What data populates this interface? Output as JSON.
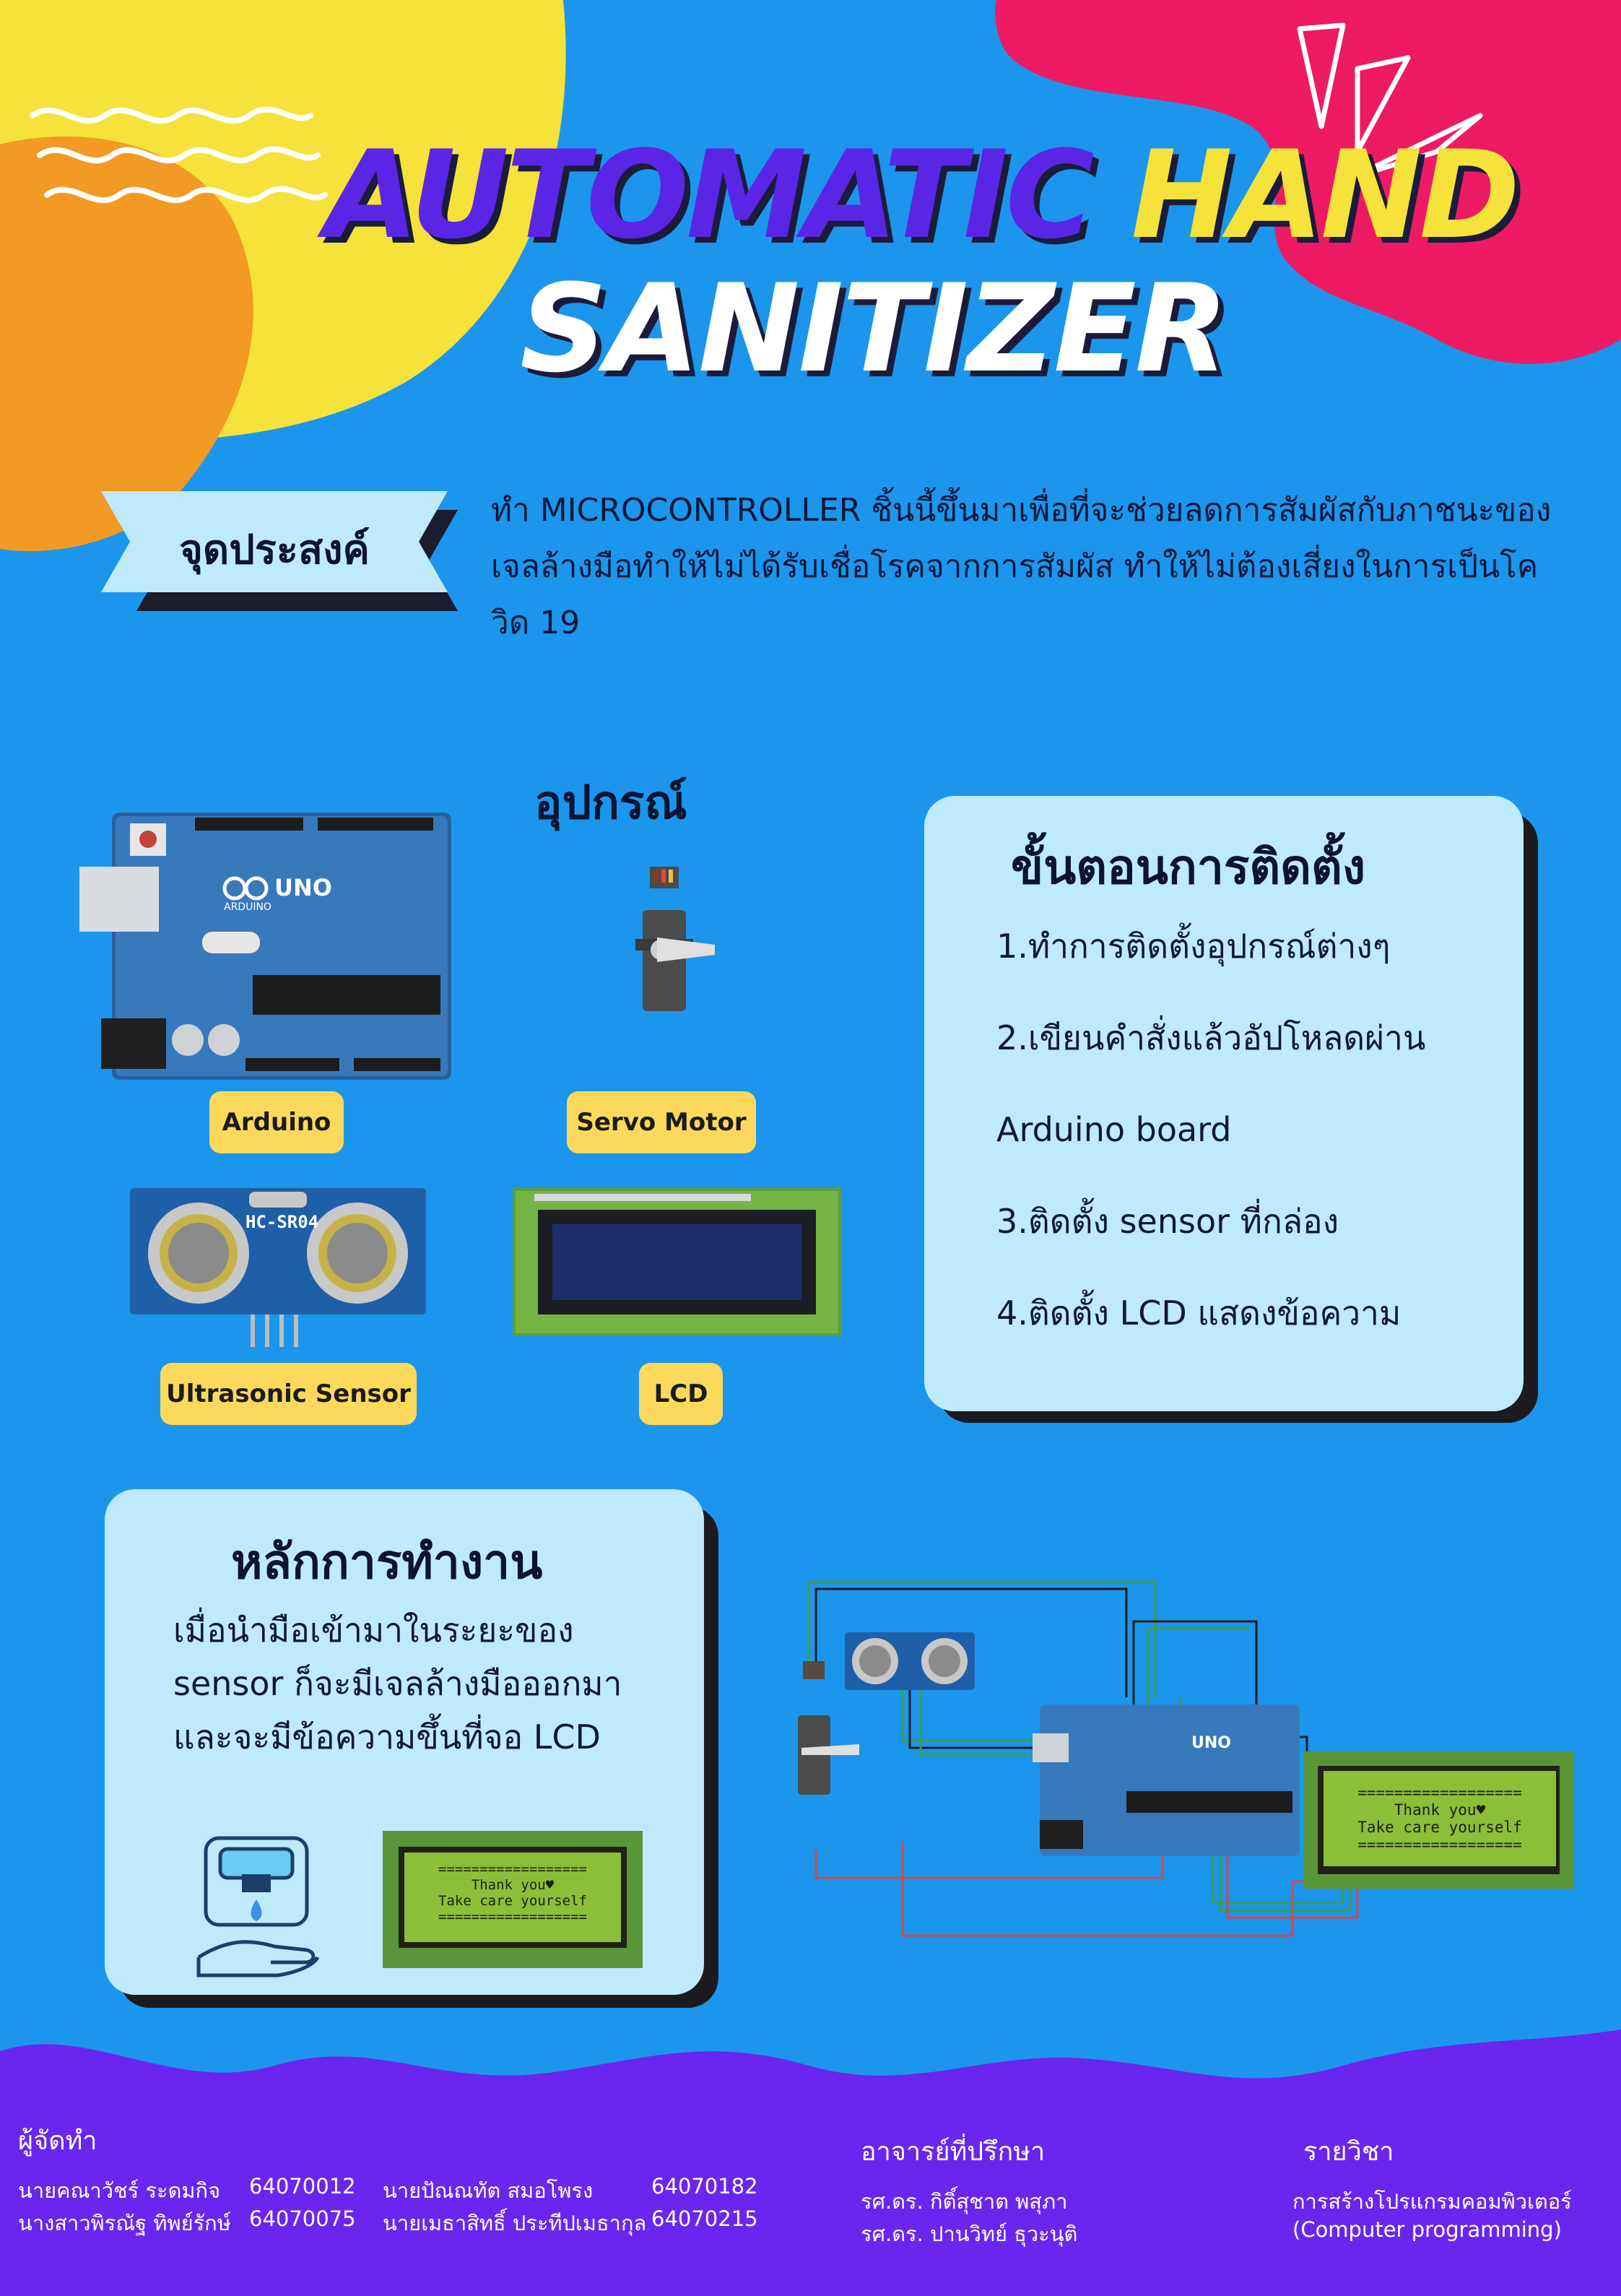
{
  "title": {
    "line1_part1": "AUTOMATIC",
    "line1_part2": "HAND",
    "line2": "SANITIZER"
  },
  "objective": {
    "label": "จุดประสงค์",
    "text": "ทำ MICROCONTROLLER ชิ้นนี้ขึ้นมาเพื่อที่จะช่วยลดการสัมผัสกับภาชนะของเจลล้างมือทำให้ไม่ได้รับเชื่อโรคจากการสัมผัส ทำให้ไม่ต้องเสี่ยงในการเป็นโควิด 19"
  },
  "equipment": {
    "title": "อุปกรณ์",
    "items": [
      "Arduino",
      "Servo Motor",
      "Ultrasonic Sensor",
      "LCD"
    ],
    "sensor_board_text": "HC-SR04",
    "arduino_board_text": "UNO",
    "arduino_brand": "ARDUINO"
  },
  "install": {
    "title": "ขั้นตอนการติดตั้ง",
    "steps": [
      "1.ทำการติดตั้งอุปกรณ์ต่างๆ",
      "2.เขียนคำสั่งแล้วอัปโหลดผ่าน",
      "Arduino board",
      "3.ติดตั้ง sensor ที่กล่อง",
      "4.ติดตั้ง LCD แสดงข้อความ"
    ]
  },
  "principle": {
    "title": "หลักการทำงาน",
    "lines": [
      "เมื่อนำมือเข้ามาในระยะของ",
      "sensor ก็จะมีเจลล้างมือออกมา",
      "และจะมีข้อความขึ้นที่จอ LCD"
    ]
  },
  "lcd_message": {
    "border": "==================",
    "line1": "Thank you♥",
    "line2": "Take care yourself"
  },
  "footer": {
    "organizers_title": "ผู้จัดทำ",
    "organizers": [
      {
        "name": "นายคณาวัชร์  ระดมกิจ",
        "id": "64070012"
      },
      {
        "name": "นางสาวพิรณัฐ ทิพย์รักษ์",
        "id": "64070075"
      },
      {
        "name": "นายปัณณทัต สมอโพรง",
        "id": "64070182"
      },
      {
        "name": "นายเมธาสิทธิ์ ประทีปเมธากุล",
        "id": "64070215"
      }
    ],
    "advisor_title": "อาจารย์ที่ปรึกษา",
    "advisors": [
      "รศ.ดร. กิติ์สุชาต พสุภา",
      "รศ.ดร. ปานวิทย์ ธุวะนุติ"
    ],
    "course_title": "รายวิชา",
    "course": [
      "การสร้างโปรแกรมคอมพิวเตอร์",
      "(Computer programming)"
    ]
  },
  "colors": {
    "background": "#1b96ec",
    "yellow": "#f5e23a",
    "orange": "#f29a24",
    "pink": "#ee1a63",
    "purple": "#5b25e6",
    "card": "#bfeafc",
    "pill": "#fcd95c"
  }
}
